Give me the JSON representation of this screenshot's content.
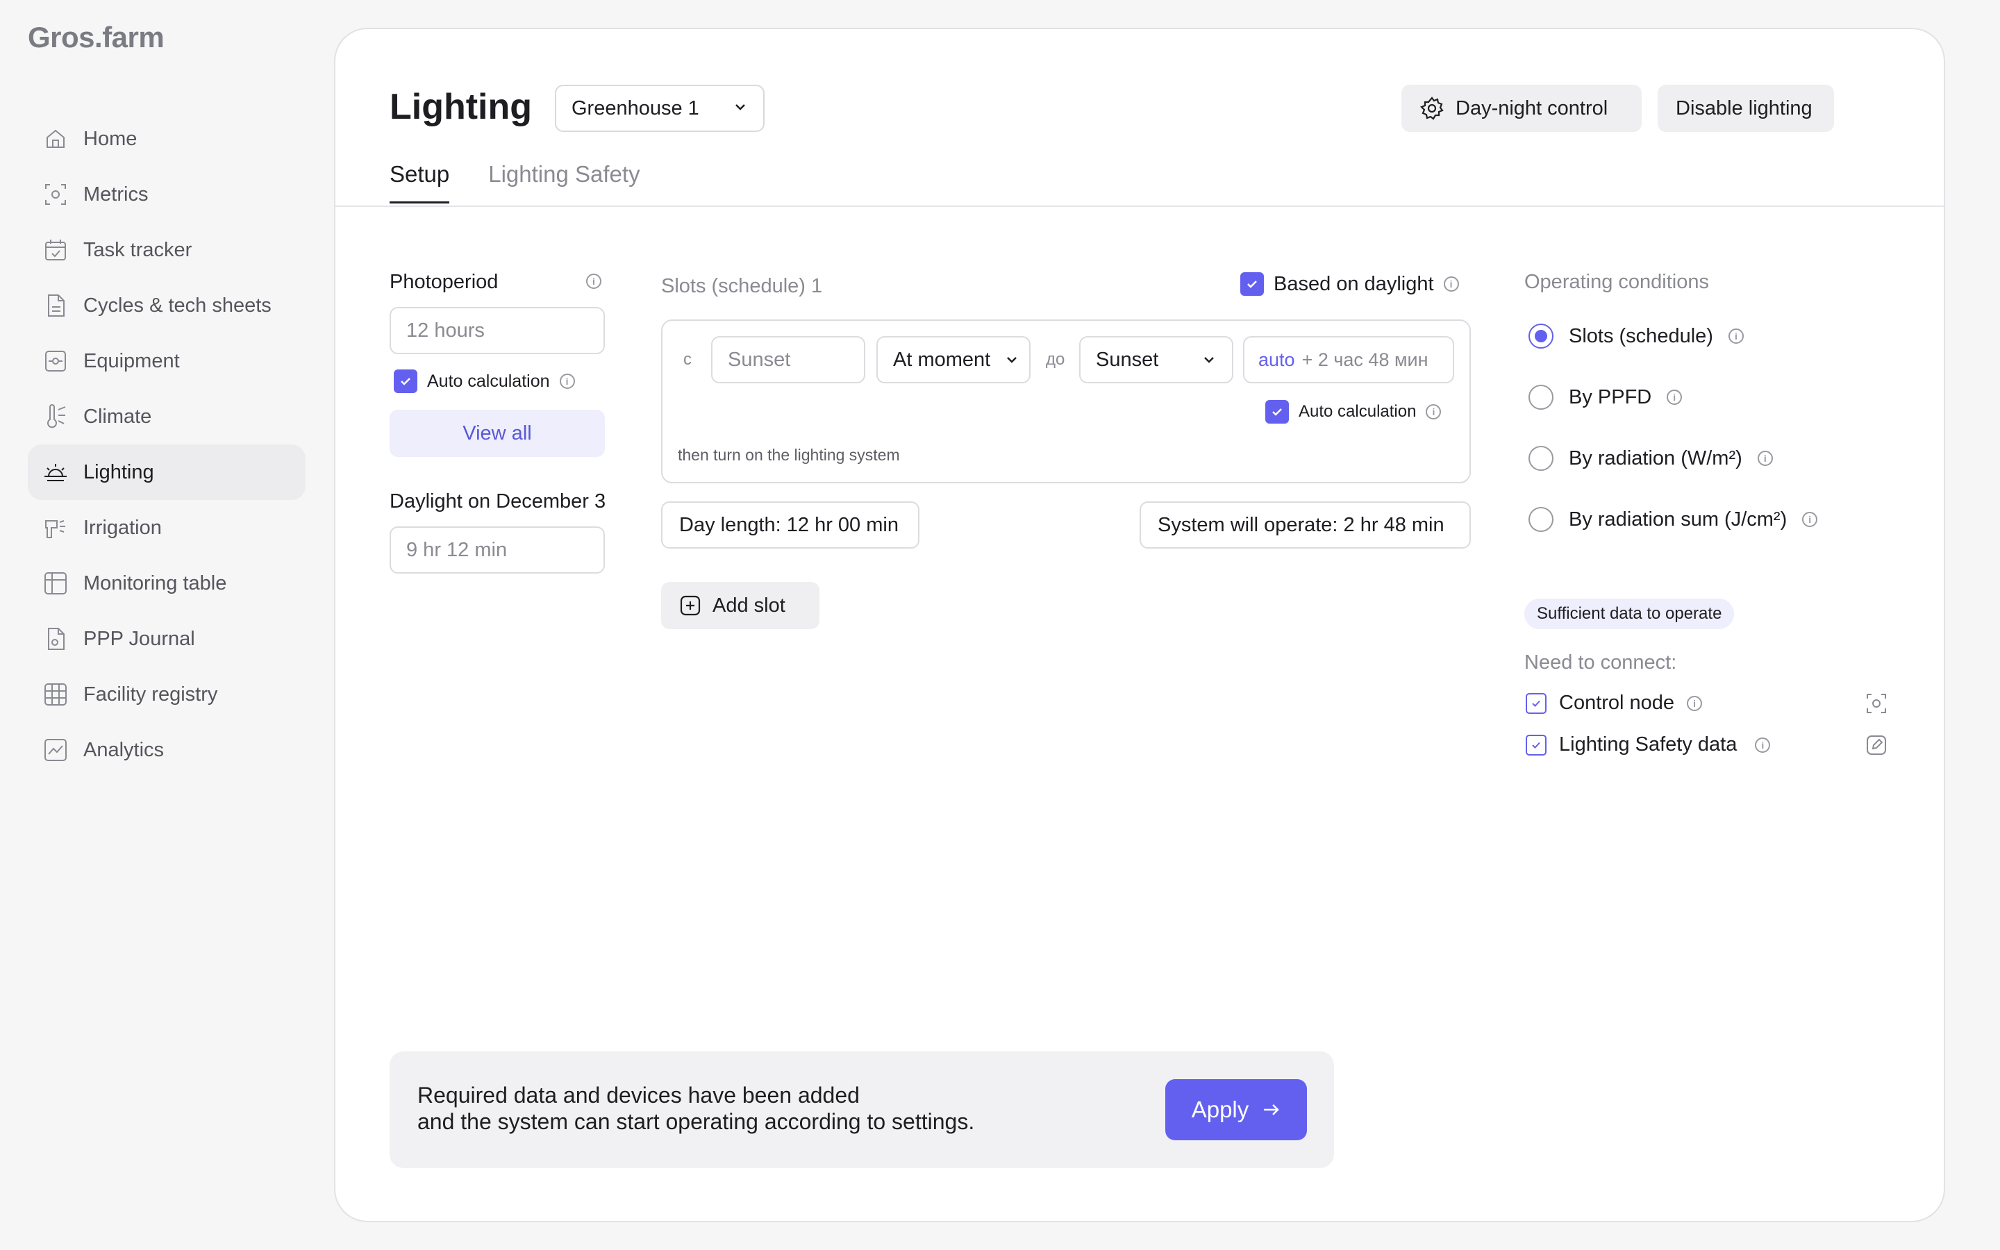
{
  "app": {
    "logo": "Gros.farm"
  },
  "sidebar": {
    "items": [
      {
        "label": "Home",
        "icon": "home-icon"
      },
      {
        "label": "Metrics",
        "icon": "metrics-icon"
      },
      {
        "label": "Task tracker",
        "icon": "calendar-check-icon"
      },
      {
        "label": "Cycles & tech sheets",
        "icon": "document-icon"
      },
      {
        "label": "Equipment",
        "icon": "equipment-icon"
      },
      {
        "label": "Climate",
        "icon": "thermometer-icon"
      },
      {
        "label": "Lighting",
        "icon": "sunrise-icon",
        "active": true
      },
      {
        "label": "Irrigation",
        "icon": "irrigation-icon"
      },
      {
        "label": "Monitoring table",
        "icon": "table-icon"
      },
      {
        "label": "PPP Journal",
        "icon": "journal-icon"
      },
      {
        "label": "Facility registry",
        "icon": "grid-icon"
      },
      {
        "label": "Analytics",
        "icon": "chart-icon"
      }
    ]
  },
  "header": {
    "title": "Lighting",
    "greenhouse_select": "Greenhouse 1",
    "day_night_label": "Day-night control",
    "disable_label": "Disable lighting"
  },
  "tabs": [
    {
      "label": "Setup",
      "active": true
    },
    {
      "label": "Lighting Safety",
      "active": false
    }
  ],
  "photoperiod": {
    "label": "Photoperiod",
    "placeholder": "12 hours",
    "auto_calc_label": "Auto calculation",
    "view_all_label": "View all"
  },
  "daylight": {
    "label": "Daylight on December 3",
    "placeholder": "9 hr 12 min"
  },
  "slots": {
    "title": "Slots (schedule) 1",
    "based_on_daylight": "Based on daylight",
    "from_prefix": "с",
    "from_placeholder": "Sunset",
    "moment_select": "At moment",
    "to_prefix": "до",
    "to_select": "Sunset",
    "auto_prefix": "auto",
    "auto_value": "+ 2 час 48 мин",
    "auto_calc_label": "Auto calculation",
    "then_text": "then turn on the lighting system",
    "day_length": "Day length: 12 hr 00 min",
    "system_operate": "System will operate: 2 hr 48 min",
    "add_slot": "Add slot"
  },
  "conditions": {
    "title": "Operating conditions",
    "options": [
      {
        "label": "Slots (schedule)",
        "selected": true
      },
      {
        "label": "By PPFD",
        "selected": false
      },
      {
        "label": "By radiation (W/m²)",
        "selected": false
      },
      {
        "label": "By radiation sum (J/cm²)",
        "selected": false
      }
    ],
    "badge": "Sufficient data to operate",
    "need_connect": "Need to connect:",
    "connections": [
      {
        "label": "Control node",
        "icon": "node-icon"
      },
      {
        "label": "Lighting Safety data",
        "icon": "edit-icon"
      }
    ]
  },
  "footer": {
    "line1": "Required data and devices have been added",
    "line2": "and the system can start operating according to settings.",
    "apply_label": "Apply"
  },
  "colors": {
    "accent": "#6360f0",
    "accent_light": "#eeeefc"
  }
}
